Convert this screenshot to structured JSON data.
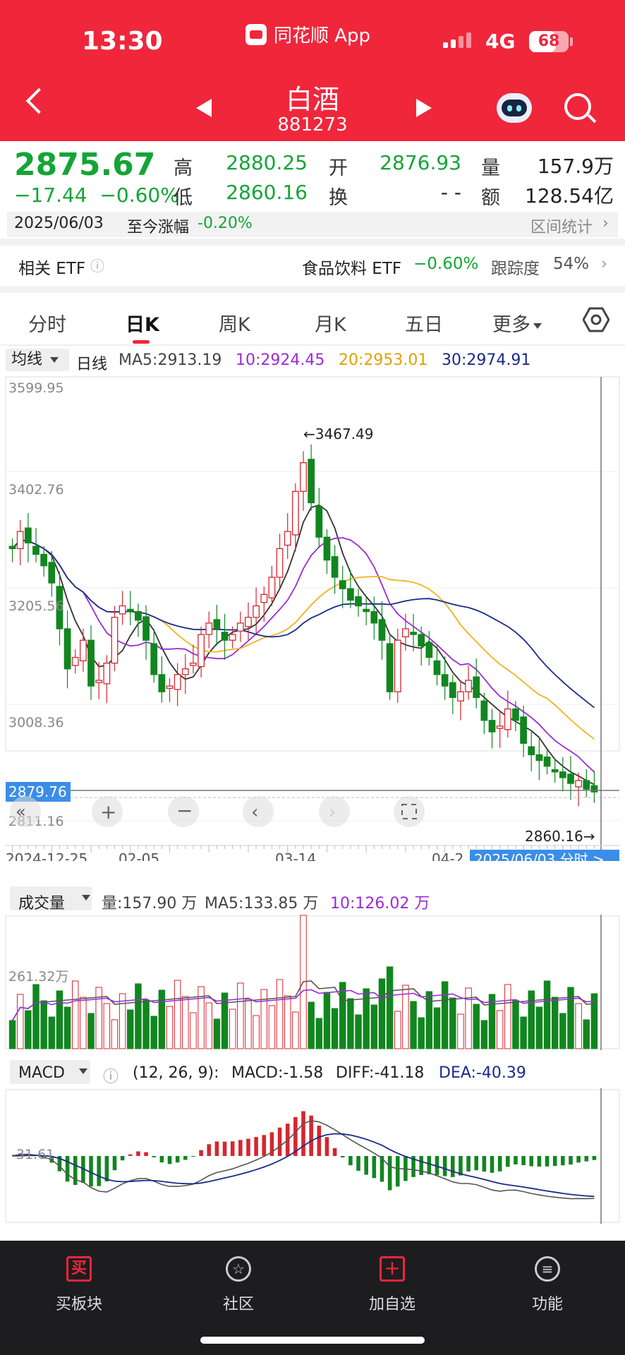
{
  "status": {
    "time": "13:30",
    "app": "同花顺 App",
    "network": "4G",
    "battery": "68",
    "battery_level": 0.68
  },
  "header": {
    "title": "白酒",
    "code": "881273"
  },
  "quote": {
    "price": "2875.67",
    "change": "−17.44",
    "change_pct": "−0.60%",
    "high_label": "高",
    "high": "2880.25",
    "low_label": "低",
    "low": "2860.16",
    "open_label": "开",
    "open": "2876.93",
    "turnover_label": "换",
    "turnover": "- -",
    "volume_label": "量",
    "volume": "157.9万",
    "amount_label": "额",
    "amount": "128.54亿",
    "date": "2025/06/03",
    "since_label": "至今涨幅",
    "since_value": "-0.20%",
    "range_stats": "区间统计"
  },
  "etf": {
    "label": "相关 ETF",
    "name": "食品饮料 ETF",
    "pct": "−0.60%",
    "track_label": "跟踪度",
    "track_value": "54%"
  },
  "tabs": [
    {
      "label": "分时",
      "active": false
    },
    {
      "label": "日K",
      "active": true
    },
    {
      "label": "周K",
      "active": false
    },
    {
      "label": "月K",
      "active": false
    },
    {
      "label": "五日",
      "active": false
    },
    {
      "label": "更多",
      "active": false
    }
  ],
  "ma": {
    "select": "均线",
    "period": "日线",
    "ma5": "MA5:2913.19",
    "ma10": "10:2924.45",
    "ma20": "20:2953.01",
    "ma30": "30:2974.91"
  },
  "chart_data": {
    "type": "candlestick",
    "y_ticks": [
      "3599.95",
      "3402.76",
      "3205.56",
      "3008.36",
      "2811.16"
    ],
    "current_price_label": "2879.76",
    "max_annotation": "3467.49",
    "min_annotation": "2860.16",
    "x_labels": [
      "2024-12-25",
      "02-05",
      "03-14",
      "04-2"
    ],
    "date_tag": "2025/06/03 分时 >",
    "ylim": [
      2811.16,
      3599.95
    ],
    "closes": [
      3300,
      3330,
      3310,
      3290,
      3270,
      3240,
      3160,
      3090,
      3110,
      3140,
      3060,
      3070,
      3100,
      3180,
      3200,
      3190,
      3175,
      3140,
      3080,
      3050,
      3060,
      3080,
      3090,
      3100,
      3150,
      3170,
      3160,
      3140,
      3150,
      3170,
      3180,
      3200,
      3220,
      3250,
      3300,
      3330,
      3400,
      3450,
      3380,
      3320,
      3280,
      3250,
      3230,
      3210,
      3200,
      3190,
      3170,
      3140,
      3050,
      3140,
      3160,
      3150,
      3130,
      3110,
      3080,
      3060,
      3040,
      3050,
      3070,
      3040,
      3000,
      2980,
      2990,
      3020,
      3000,
      2960,
      2940,
      2930,
      2920,
      2910,
      2900,
      2890,
      2895,
      2880,
      2875
    ]
  },
  "volume": {
    "select": "成交量",
    "vol": "量:157.90 万",
    "ma5": "MA5:133.85 万",
    "ma10": "10:126.02 万",
    "tick": "261.32万"
  },
  "macd": {
    "select": "MACD",
    "params": "(12, 26, 9):",
    "macd": "MACD:-1.58",
    "diff": "DIFF:-41.18",
    "dea": "DEA:-40.39",
    "tick": "-31.61"
  },
  "nav": [
    {
      "label": "买板块",
      "icon": "买"
    },
    {
      "label": "社区",
      "icon": "star-icon"
    },
    {
      "label": "加自选",
      "icon": "+"
    },
    {
      "label": "功能",
      "icon": "menu-icon"
    }
  ],
  "colors": {
    "red": "#f0263b",
    "green": "#13a535",
    "up": "#d7252e",
    "down": "#11861f",
    "ma5": "#333333",
    "ma10": "#9b2bd6",
    "ma20": "#f0b41c",
    "ma30": "#1a2a8c",
    "tag": "#3b8ee8"
  }
}
